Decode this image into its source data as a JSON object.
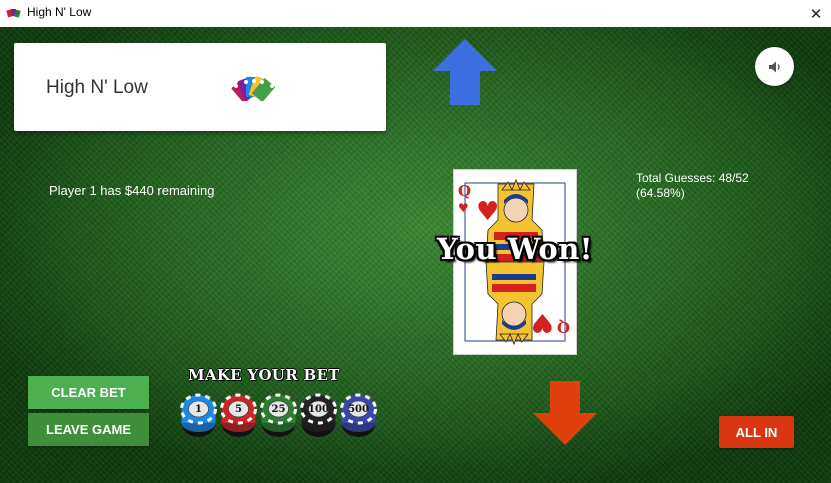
{
  "window": {
    "title": "High N' Low",
    "close_glyph": "✕"
  },
  "header": {
    "game_title": "High N' Low",
    "logo_icon": "playing-cards-fan-icon"
  },
  "player": {
    "status": "Player 1 has $440 remaining"
  },
  "stats": {
    "total_guesses": "Total Guesses: 48/52 (64.58%)"
  },
  "current_card": {
    "rank": "Q",
    "suit": "hearts",
    "suit_glyph": "♥"
  },
  "result": {
    "message": "You Won!"
  },
  "controls": {
    "higher_icon": "arrow-up-icon",
    "lower_icon": "arrow-down-icon",
    "sound_icon": "speaker-icon",
    "clear_bet": "CLEAR BET",
    "leave_game": "LEAVE GAME",
    "all_in": "ALL IN"
  },
  "bet": {
    "heading": "MAKE YOUR BET",
    "chips": [
      {
        "value": "1",
        "color": "#1e88e5"
      },
      {
        "value": "5",
        "color": "#c62828"
      },
      {
        "value": "25",
        "color": "#2e7d32"
      },
      {
        "value": "100",
        "color": "#222222"
      },
      {
        "value": "500",
        "color": "#3949ab"
      }
    ]
  },
  "colors": {
    "felt": "#2d7528",
    "up_arrow": "#3d6fe0",
    "down_arrow": "#e0400c",
    "clear_button": "#4caf50",
    "leave_button": "#3f8f3a",
    "all_in_button": "#db3613",
    "heart_red": "#d32020"
  }
}
